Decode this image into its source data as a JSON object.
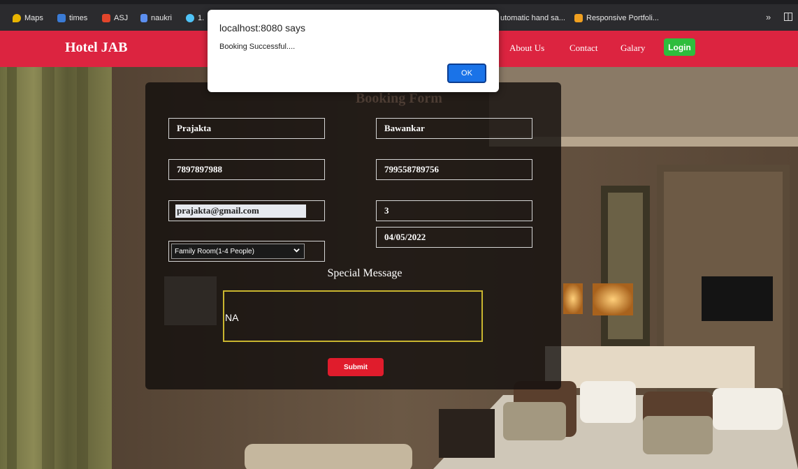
{
  "bookmarks": {
    "items": [
      "Maps",
      "times",
      "ASJ",
      "naukri",
      "1.",
      "utomatic hand sa...",
      "Responsive Portfoli..."
    ],
    "more": "»"
  },
  "navbar": {
    "brand": "Hotel JAB",
    "links": [
      "About Us",
      "Contact",
      "Galary"
    ],
    "login": "Login",
    "color": "#dc2440"
  },
  "form": {
    "title": "Booking Form",
    "first_name": "Prajakta",
    "last_name": "Bawankar",
    "phone": "7897897988",
    "id_number": "799558789756",
    "email": "prajakta@gmail.com",
    "guests": "3",
    "date": "04/05/2022",
    "room_type": "Family Room(1-4 People)",
    "special_label": "Special Message",
    "special_message": "NA",
    "submit": "Submit"
  },
  "dialog": {
    "title": "localhost:8080 says",
    "message": "Booking Successful....",
    "ok": "OK"
  }
}
